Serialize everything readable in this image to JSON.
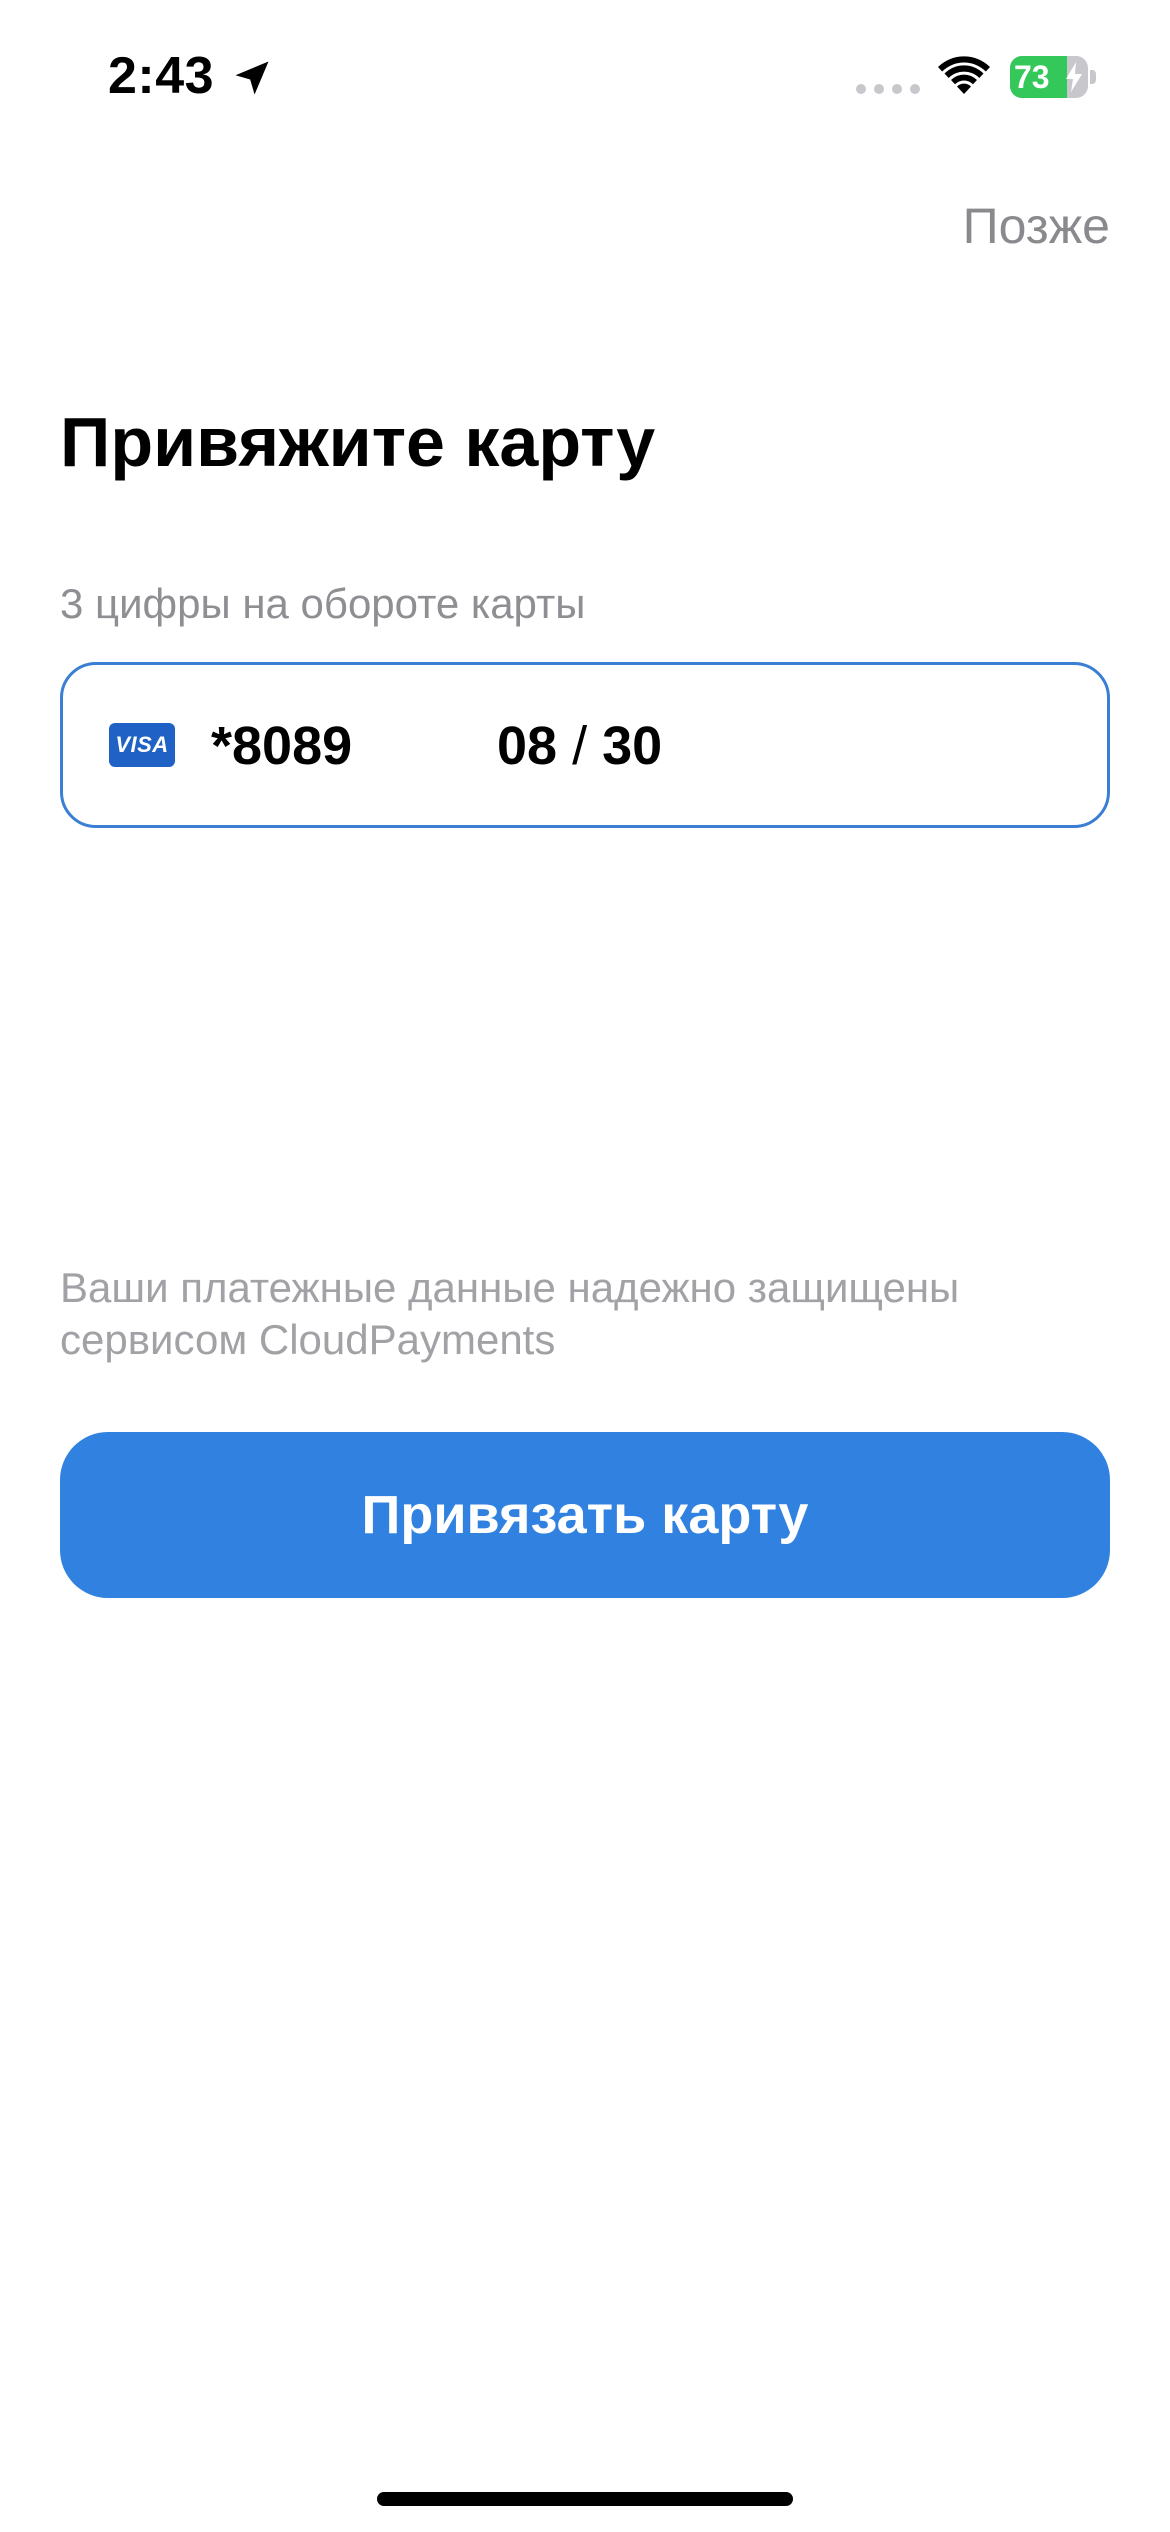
{
  "status_bar": {
    "time": "2:43",
    "battery_text": "73",
    "battery_level": 0.73,
    "icons": [
      "location-arrow-icon",
      "cellular-signal-icon",
      "wifi-icon",
      "battery-charging-icon"
    ]
  },
  "header": {
    "later_label": "Позже"
  },
  "main": {
    "title": "Привяжите карту",
    "cvv_label": "3 цифры на обороте карты",
    "card": {
      "brand": "VISA",
      "brand_icon": "visa-logo-icon",
      "number_masked": "*8089",
      "expiry_month": "08",
      "expiry_separator": "/",
      "expiry_year": "30",
      "cvv_value": "",
      "cvv_placeholder": ""
    },
    "secure_note": "Ваши платежные данные надежно защищены сервисом CloudPayments",
    "bind_button_label": "Привязать карту"
  },
  "colors": {
    "accent": "#3182e0",
    "field_border": "#3a7fd3",
    "secondary_text": "#8e8e93",
    "battery_green": "#34c759",
    "visa_blue": "#1f61c4"
  }
}
